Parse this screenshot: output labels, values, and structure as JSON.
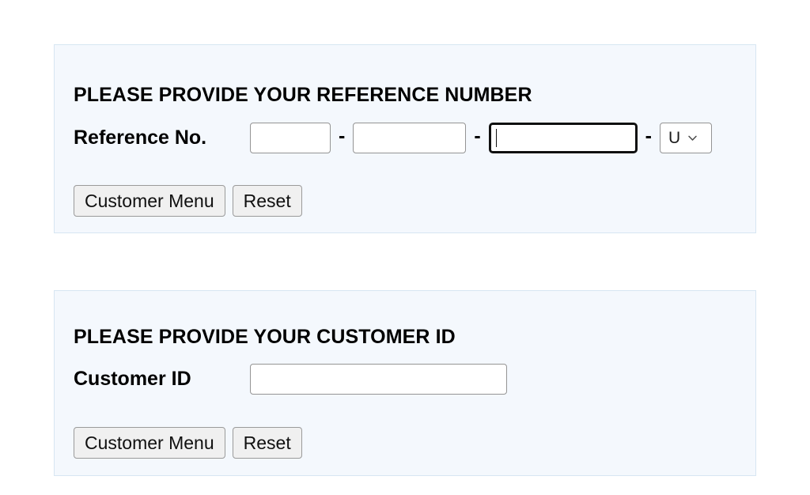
{
  "page": {
    "background_color": "#ffffff",
    "panel_background_color": "#f4f8fd",
    "panel_border_color": "#d7e6f2"
  },
  "reference_panel": {
    "title": "PLEASE PROVIDE YOUR REFERENCE NUMBER",
    "field_label": "Reference No.",
    "separator": "-",
    "segments": [
      {
        "name": "segment-1",
        "value": "",
        "placeholder": "",
        "focused": false
      },
      {
        "name": "segment-2",
        "value": "",
        "placeholder": "",
        "focused": false
      },
      {
        "name": "segment-3",
        "value": "",
        "placeholder": "",
        "focused": true
      }
    ],
    "suffix_select": {
      "selected": "U",
      "options": [
        "U"
      ],
      "arrow_icon": "chevron-down-icon"
    },
    "buttons": [
      {
        "name": "customer-menu-button",
        "label": "Customer Menu"
      },
      {
        "name": "reset-button",
        "label": "Reset"
      }
    ]
  },
  "customer_panel": {
    "title": "PLEASE PROVIDE YOUR CUSTOMER ID",
    "field_label": "Customer ID",
    "input": {
      "value": "",
      "placeholder": ""
    },
    "buttons": [
      {
        "name": "customer-menu-button",
        "label": "Customer Menu"
      },
      {
        "name": "reset-button",
        "label": "Reset"
      }
    ]
  }
}
